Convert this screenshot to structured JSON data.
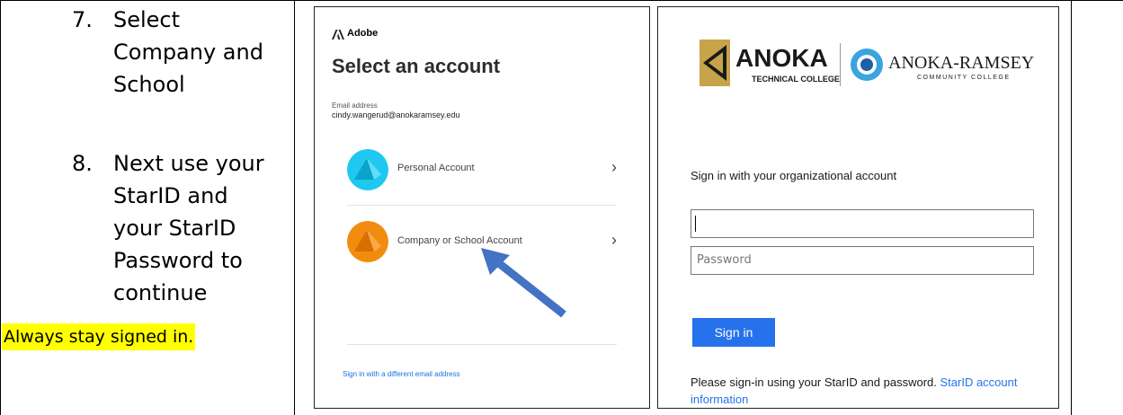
{
  "instructions": {
    "step7_num": "7.",
    "step7_lines": [
      "Select",
      "Company and",
      "School"
    ],
    "step8_num": "8.",
    "step8_lines": [
      "Next use your",
      "StarID and",
      "your StarID",
      "Password to",
      "continue"
    ],
    "note": "Always stay signed in."
  },
  "adobe": {
    "brand": "Adobe",
    "title": "Select an account",
    "email_label": "Email address",
    "email_value": "cindy.wangerud@anokaramsey.edu",
    "accounts": [
      {
        "label": "Personal Account",
        "color": "#1ec8f0"
      },
      {
        "label": "Company or School Account",
        "color": "#f28c0f"
      }
    ],
    "different_email": "Sign in with a different email address",
    "arrow_color": "#4472c4"
  },
  "anoka": {
    "logo_left_main": "ANOKA",
    "logo_left_sub": "TECHNICAL COLLEGE",
    "logo_right_main": "ANOKA-RAMSEY",
    "logo_right_sub": "COMMUNITY COLLEGE",
    "prompt": "Sign in with your organizational account",
    "username_value": "",
    "password_placeholder": "Password",
    "signin_label": "Sign in",
    "help_text": "Please sign-in using your StarID and password.",
    "help_link": "StarID account information",
    "accent": "#2672ec"
  }
}
